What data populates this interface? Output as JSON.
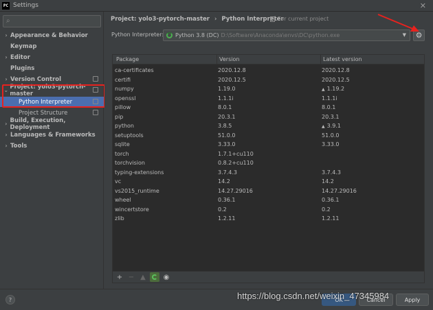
{
  "window": {
    "title": "Settings",
    "logo_text": "PC"
  },
  "sidebar": {
    "items": [
      {
        "label": "Appearance & Behavior",
        "expandable": true
      },
      {
        "label": "Keymap",
        "expandable": false
      },
      {
        "label": "Editor",
        "expandable": true
      },
      {
        "label": "Plugins",
        "expandable": false
      },
      {
        "label": "Version Control",
        "expandable": true
      },
      {
        "label": "Project: yolo3-pytorch-master",
        "expandable": true,
        "expanded": true
      },
      {
        "label": "Python Interpreter",
        "sub": true,
        "selected": true
      },
      {
        "label": "Project Structure",
        "sub": true
      },
      {
        "label": "Build, Execution, Deployment",
        "expandable": true
      },
      {
        "label": "Languages & Frameworks",
        "expandable": true
      },
      {
        "label": "Tools",
        "expandable": true
      }
    ]
  },
  "header": {
    "breadcrumb_project": "Project: yolo3-pytorch-master",
    "breadcrumb_separator": "›",
    "breadcrumb_current": "Python Interpreter",
    "scope": "For current project"
  },
  "interpreter": {
    "label": "Python Interpreter:",
    "name": "Python 3.8 (DC)",
    "path": "D:\\Software\\Anaconda\\envs\\DC\\python.exe"
  },
  "table": {
    "columns": [
      "Package",
      "Version",
      "Latest version"
    ],
    "rows": [
      {
        "package": "ca-certificates",
        "version": "2020.12.8",
        "latest": "2020.12.8",
        "upgrade": false
      },
      {
        "package": "certifi",
        "version": "2020.12.5",
        "latest": "2020.12.5",
        "upgrade": false
      },
      {
        "package": "numpy",
        "version": "1.19.0",
        "latest": "1.19.2",
        "upgrade": true
      },
      {
        "package": "openssl",
        "version": "1.1.1i",
        "latest": "1.1.1i",
        "upgrade": false
      },
      {
        "package": "pillow",
        "version": "8.0.1",
        "latest": "8.0.1",
        "upgrade": false
      },
      {
        "package": "pip",
        "version": "20.3.1",
        "latest": "20.3.1",
        "upgrade": false
      },
      {
        "package": "python",
        "version": "3.8.5",
        "latest": "3.9.1",
        "upgrade": true
      },
      {
        "package": "setuptools",
        "version": "51.0.0",
        "latest": "51.0.0",
        "upgrade": false
      },
      {
        "package": "sqlite",
        "version": "3.33.0",
        "latest": "3.33.0",
        "upgrade": false
      },
      {
        "package": "torch",
        "version": "1.7.1+cu110",
        "latest": "",
        "upgrade": false
      },
      {
        "package": "torchvision",
        "version": "0.8.2+cu110",
        "latest": "",
        "upgrade": false
      },
      {
        "package": "typing-extensions",
        "version": "3.7.4.3",
        "latest": "3.7.4.3",
        "upgrade": false
      },
      {
        "package": "vc",
        "version": "14.2",
        "latest": "14.2",
        "upgrade": false
      },
      {
        "package": "vs2015_runtime",
        "version": "14.27.29016",
        "latest": "14.27.29016",
        "upgrade": false
      },
      {
        "package": "wheel",
        "version": "0.36.1",
        "latest": "0.36.1",
        "upgrade": false
      },
      {
        "package": "wincertstore",
        "version": "0.2",
        "latest": "0.2",
        "upgrade": false
      },
      {
        "package": "zlib",
        "version": "1.2.11",
        "latest": "1.2.11",
        "upgrade": false
      }
    ]
  },
  "toolbar": {
    "add": "+",
    "remove": "−",
    "upgrade": "▲",
    "show_early": "👁"
  },
  "footer": {
    "help": "?",
    "ok": "OK",
    "cancel": "Cancel",
    "apply": "Apply"
  },
  "watermark": "https://blog.csdn.net/weixin_47345984",
  "colors": {
    "selection": "#4b6eaf",
    "highlight_box": "#e8221e",
    "annotation_arrow": "#e8221e"
  }
}
